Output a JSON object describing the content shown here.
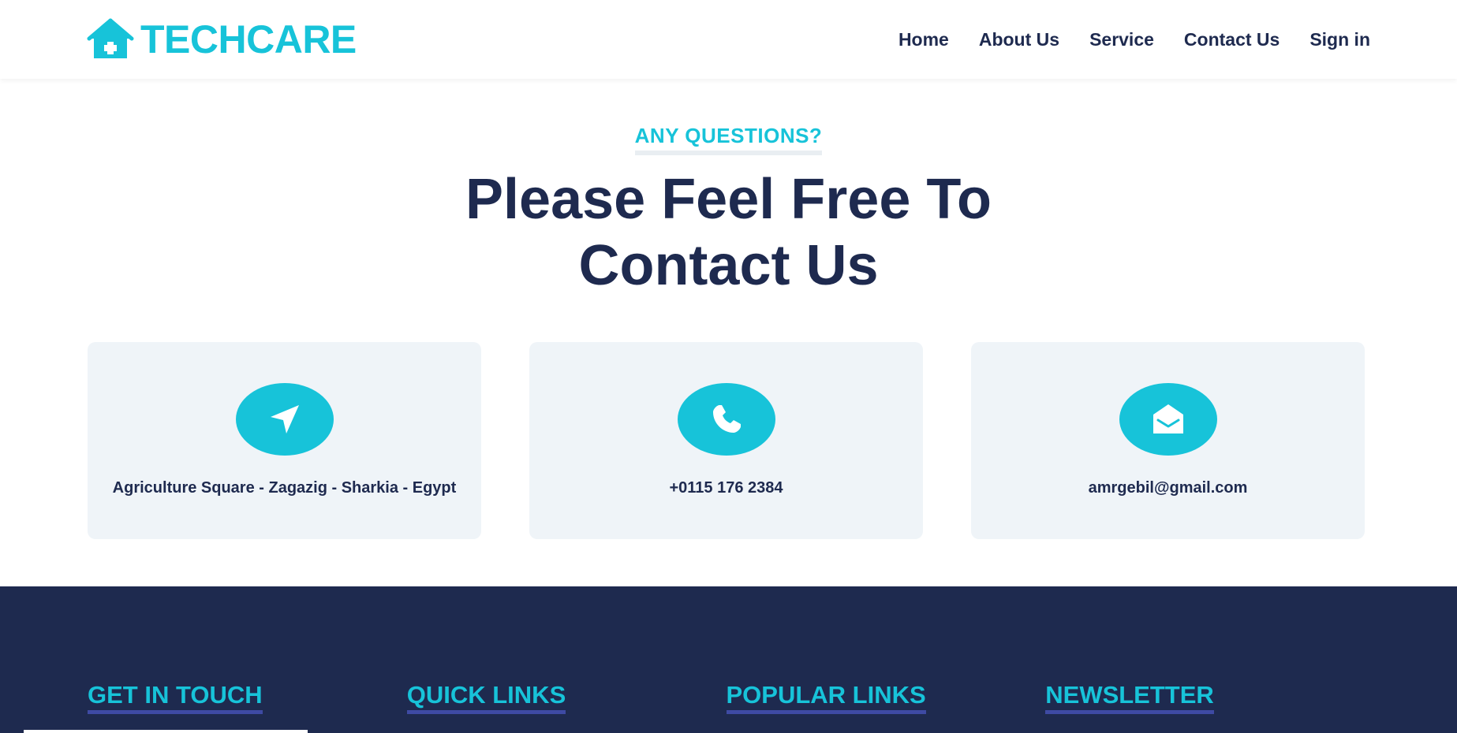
{
  "brand": {
    "name": "TECHCARE",
    "icon": "house-medical-icon",
    "color": "#17c3d9"
  },
  "nav": {
    "items": [
      {
        "label": "Home"
      },
      {
        "label": "About Us"
      },
      {
        "label": "Service"
      },
      {
        "label": "Contact Us"
      },
      {
        "label": "Sign in"
      }
    ]
  },
  "hero": {
    "kicker": "ANY QUESTIONS?",
    "title_line1": "Please Feel Free To",
    "title_line2": "Contact Us"
  },
  "cards": [
    {
      "icon": "location-arrow-icon",
      "text": "Agriculture Square - Zagazig - Sharkia - Egypt"
    },
    {
      "icon": "phone-icon",
      "text": "+0115 176 2384"
    },
    {
      "icon": "envelope-open-icon",
      "text": "amrgebil@gmail.com"
    }
  ],
  "footer": {
    "columns": [
      {
        "title": "GET IN TOUCH"
      },
      {
        "title": "QUICK LINKS"
      },
      {
        "title": "POPULAR LINKS"
      },
      {
        "title": "NEWSLETTER"
      }
    ]
  },
  "colors": {
    "accent": "#17c3d9",
    "navy": "#1e2a4f",
    "card_bg": "#eff4f8",
    "underline": "#3e4aa3"
  }
}
